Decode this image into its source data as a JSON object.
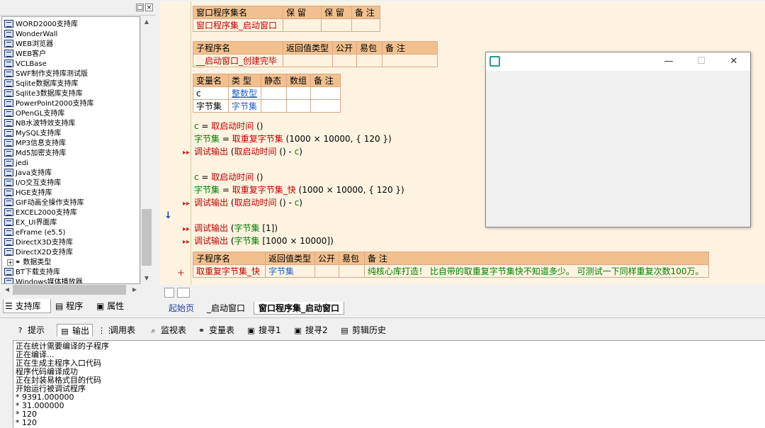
{
  "left_panel": {
    "tree_items": [
      "WORD2000支持库",
      "WonderWall",
      "WEB浏览器",
      "WEB客户",
      "VCLBase",
      "SWF制作支持库测试版",
      "Sqlite数据库支持库",
      "Sqlite3数据库支持库",
      "PowerPoint2000支持库",
      "OPenGL支持库",
      "NB水波特效支持库",
      "MySQL支持库",
      "MP3信息支持库",
      "Md5加密支持库",
      "jedi",
      "Java支持库",
      "I/O交互支持库",
      "HGE支持库",
      "GIF动画全操作支持库",
      "EXCEL2000支持库",
      "EX_UI界面库",
      "eFrame (e5.5)",
      "DirectX3D支持库",
      "DirectX2D支持库",
      "数据类型",
      "BT下载支持库",
      "Windows媒体播放器"
    ],
    "tabs": [
      "支持库",
      "程序",
      "属性"
    ]
  },
  "editor": {
    "assembly_table": {
      "headers": [
        "窗口程序集名",
        "保 留",
        "保 留",
        "备 注"
      ],
      "row": [
        "窗口程序集_启动窗口",
        "",
        "",
        ""
      ]
    },
    "sub1_table": {
      "headers": [
        "子程序名",
        "返回值类型",
        "公开",
        "易包",
        "备 注"
      ],
      "row": [
        "__启动窗口_创建完毕",
        "",
        "",
        "",
        ""
      ]
    },
    "var_table": {
      "headers": [
        "变量名",
        "类 型",
        "静态",
        "数组",
        "备 注"
      ],
      "rows": [
        [
          "c",
          "整数型",
          "",
          "",
          ""
        ],
        [
          "字节集",
          "字节集",
          "",
          "",
          ""
        ]
      ]
    },
    "code": {
      "l1a": "c",
      "l1b": " = ",
      "l1c": "取启动时间",
      "l1d": " ()",
      "l2a": "字节集",
      "l2b": " = ",
      "l2c": "取重复字节集",
      "l2d": " (1000 × 10000, { 120 })",
      "l3a": "调试输出",
      "l3b": " (",
      "l3c": "取启动时间",
      "l3d": " () - ",
      "l3e": "c",
      "l3f": ")",
      "l4a": "c",
      "l4b": " = ",
      "l4c": "取启动时间",
      "l4d": " ()",
      "l5a": "字节集",
      "l5b": " = ",
      "l5c": "取重复字节集_快",
      "l5d": " (1000 × 10000, { 120 })",
      "l6a": "调试输出",
      "l6b": " (",
      "l6c": "取启动时间",
      "l6d": " () - ",
      "l6e": "c",
      "l6f": ")",
      "l7a": "调试输出",
      "l7b": " (",
      "l7c": "字节集",
      "l7d": " [1])",
      "l8a": "调试输出",
      "l8b": " (",
      "l8c": "字节集",
      "l8d": " [1000 × 10000])"
    },
    "sub2_table": {
      "headers": [
        "子程序名",
        "返回值类型",
        "公开",
        "易包",
        "备 注"
      ],
      "row": [
        "取重复字节集_快",
        "字节集",
        "",
        "",
        "纯核心库打造！ 比自带的取重复字节集快不知道多少。 可测试一下同样重复次数100万。"
      ]
    },
    "markers": {
      "arrow": "↓",
      "plus": "+",
      "exec": "▸▸"
    }
  },
  "doc_tabs": [
    "起始页",
    "_启动窗口",
    "窗口程序集_启动窗口"
  ],
  "bottom_tabs": [
    "提示",
    "输出",
    "调用表",
    "监视表",
    "变量表",
    "搜寻1",
    "搜寻2",
    "剪辑历史"
  ],
  "output_lines": [
    "正在统计需要编译的子程序",
    "正在编译...",
    "正在生成主程序入口代码",
    "程序代码编译成功",
    "正在封装易格式目的代码",
    "开始运行被调试程序",
    "* 9391.000000",
    "* 31.000000",
    "* 120",
    "* 120"
  ],
  "window_buttons": {
    "minimize": "—",
    "maximize": "☐",
    "close": "✕"
  },
  "left_top_buttons": {
    "dock": "□",
    "close": "×"
  },
  "colors": {
    "editor_bg": "#fdf3e0",
    "table_header": "#f2c08e",
    "red_text": "#c00000",
    "blue_text": "#1f5fc8",
    "green_text": "#008000"
  }
}
